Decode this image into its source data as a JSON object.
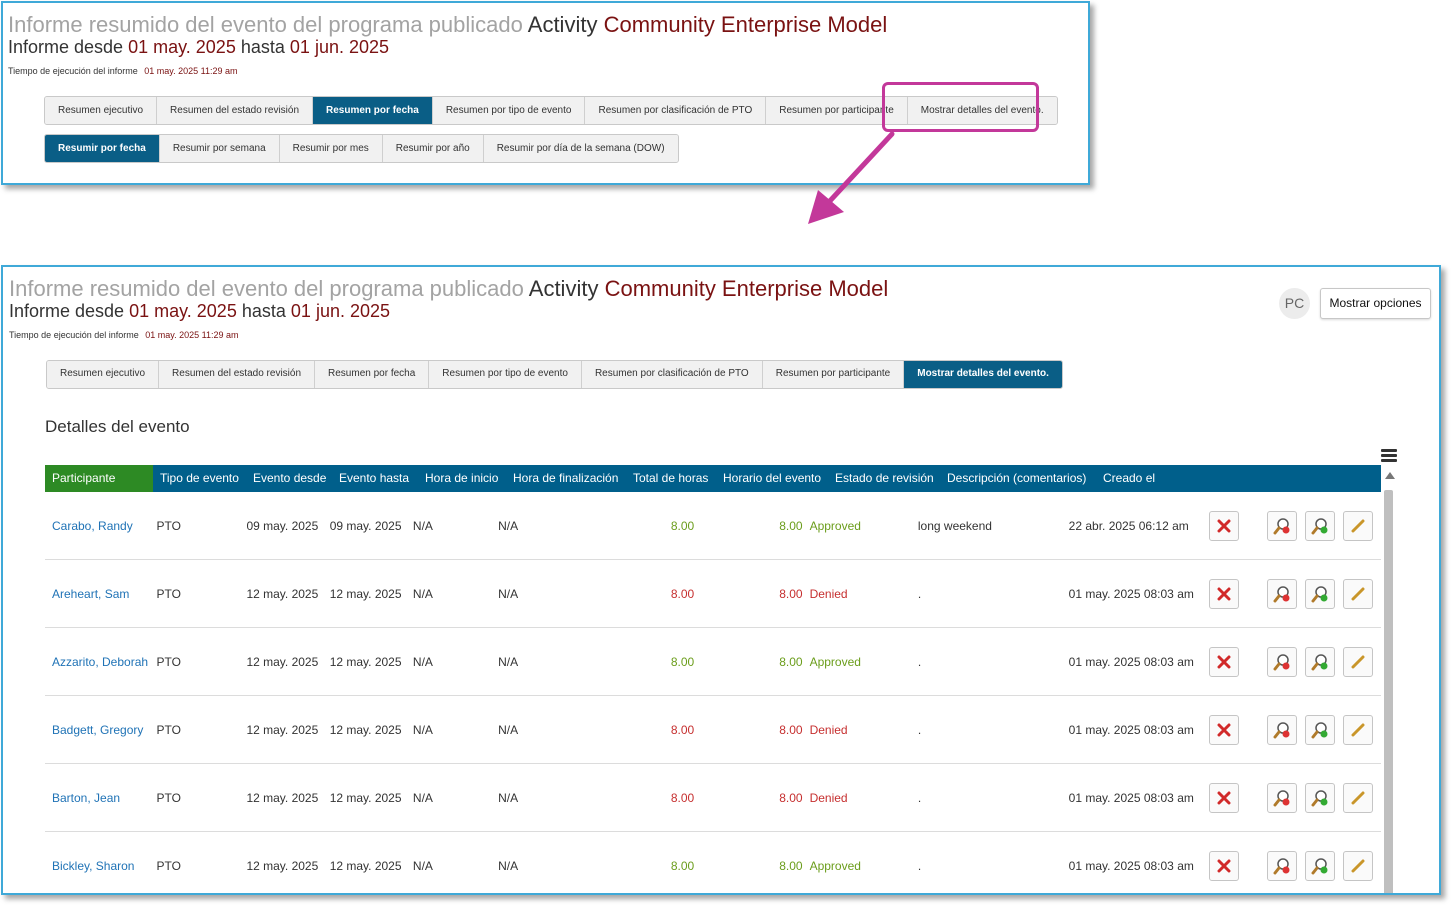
{
  "report": {
    "title_prefix": "Informe resumido del evento del programa publicado",
    "title_word": "Activity",
    "title_program": "Community Enterprise Model",
    "range_prefix": "Informe desde",
    "range_from": "01 may. 2025",
    "range_mid": "hasta",
    "range_to": "01 jun. 2025",
    "runtime_label": "Tiempo de ejecución del informe",
    "runtime_value": "01 may. 2025 11:29 am"
  },
  "tabs": [
    {
      "label": "Resumen ejecutivo"
    },
    {
      "label": "Resumen del estado revisión"
    },
    {
      "label": "Resumen por fecha"
    },
    {
      "label": "Resumen por tipo de evento"
    },
    {
      "label": "Resumen por clasificación de PTO"
    },
    {
      "label": "Resumen por participante"
    },
    {
      "label": "Mostrar detalles del evento."
    }
  ],
  "subtabs": [
    {
      "label": "Resumir por fecha"
    },
    {
      "label": "Resumir por semana"
    },
    {
      "label": "Resumir por mes"
    },
    {
      "label": "Resumir por año"
    },
    {
      "label": "Resumir por día de la semana (DOW)"
    }
  ],
  "top_active_tab": "Resumen por fecha",
  "top_active_subtab": "Resumir por fecha",
  "bottom_active_tab": "Mostrar detalles del evento.",
  "header": {
    "avatar_initials": "PC",
    "options_button": "Mostrar opciones"
  },
  "section_title": "Detalles del evento",
  "columns": [
    "Participante",
    "Tipo de evento",
    "Evento desde",
    "Evento hasta",
    "Hora de inicio",
    "Hora de finalización",
    "Total de horas",
    "Horario del evento",
    "Estado de revisión",
    "Descripción (comentarios)",
    "Creado el"
  ],
  "rows": [
    {
      "participant": "Carabo, Randy",
      "type": "PTO",
      "from": "09 may. 2025",
      "to": "09 may. 2025",
      "start": "N/A",
      "end": "N/A",
      "total": "8.00",
      "schedule": "8.00",
      "status": "Approved",
      "desc": "long weekend",
      "created": "22 abr. 2025 06:12 am"
    },
    {
      "participant": "Areheart, Sam",
      "type": "PTO",
      "from": "12 may. 2025",
      "to": "12 may. 2025",
      "start": "N/A",
      "end": "N/A",
      "total": "8.00",
      "schedule": "8.00",
      "status": "Denied",
      "desc": ".",
      "created": "01 may. 2025 08:03 am"
    },
    {
      "participant": "Azzarito, Deborah",
      "type": "PTO",
      "from": "12 may. 2025",
      "to": "12 may. 2025",
      "start": "N/A",
      "end": "N/A",
      "total": "8.00",
      "schedule": "8.00",
      "status": "Approved",
      "desc": ".",
      "created": "01 may. 2025 08:03 am"
    },
    {
      "participant": "Badgett, Gregory",
      "type": "PTO",
      "from": "12 may. 2025",
      "to": "12 may. 2025",
      "start": "N/A",
      "end": "N/A",
      "total": "8.00",
      "schedule": "8.00",
      "status": "Denied",
      "desc": ".",
      "created": "01 may. 2025 08:03 am"
    },
    {
      "participant": "Barton, Jean",
      "type": "PTO",
      "from": "12 may. 2025",
      "to": "12 may. 2025",
      "start": "N/A",
      "end": "N/A",
      "total": "8.00",
      "schedule": "8.00",
      "status": "Denied",
      "desc": ".",
      "created": "01 may. 2025 08:03 am"
    },
    {
      "participant": "Bickley, Sharon",
      "type": "PTO",
      "from": "12 may. 2025",
      "to": "12 may. 2025",
      "start": "N/A",
      "end": "N/A",
      "total": "8.00",
      "schedule": "8.00",
      "status": "Approved",
      "desc": ".",
      "created": "01 may. 2025 08:03 am"
    }
  ],
  "colors": {
    "accent": "#005f8b",
    "first_col_header": "#2d8a24",
    "approved": "#6b9d1b",
    "denied": "#c62f2f",
    "highlight": "#c3389a",
    "title_red": "#7a1212"
  },
  "icons": {
    "delete": "delete-x-icon",
    "deny_view": "magnify-deny-icon",
    "approve_view": "magnify-approve-icon",
    "edit": "edit-icon"
  }
}
